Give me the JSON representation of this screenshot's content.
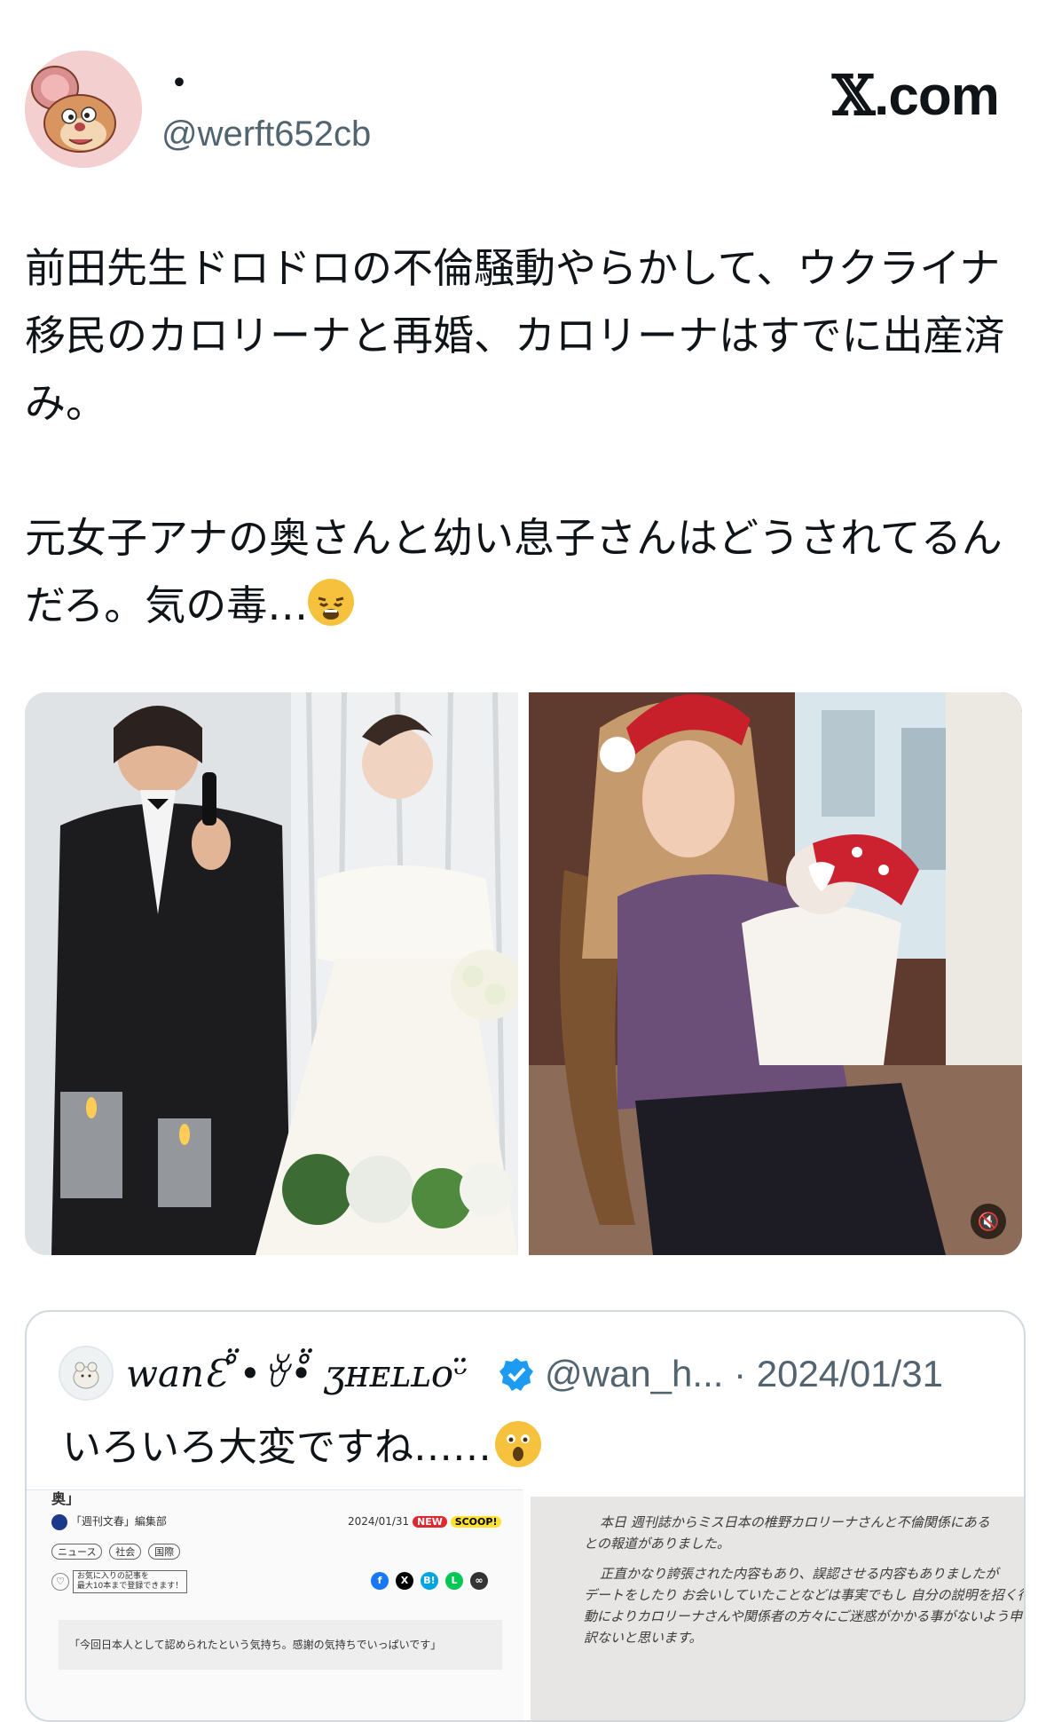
{
  "header": {
    "display_name": "・",
    "handle": "@werft652cb",
    "brand_x": "𝕏",
    "brand_suffix": ".com",
    "avatar_icon": "cartoon-mouse-avatar"
  },
  "tweet": {
    "line1": "前田先生ドロドロの不倫騒動やらかして、ウクライナ移民のカロリーナと再婚、カロリーナはすでに出産済み。",
    "line2": "元女子アナの奥さんと幼い息子さんはどうされてるんだろ。気の毒…",
    "emoji": "weary-face-emoji"
  },
  "media": {
    "items": [
      {
        "name": "wedding-photo",
        "icon": "photo"
      },
      {
        "name": "mother-baby-photo",
        "icon": "photo"
      }
    ],
    "mute_icon": "🔇"
  },
  "quote": {
    "display_name": "wanƐ ̊̈•ꈊ•̊̈ ʒʜᴇʟʟᴏᵕ̈",
    "handle_date": "@wan_h... · 2024/01/31",
    "text": "いろいろ大変ですね……",
    "verified_color": "#1d9bf0",
    "article": {
      "top_fragment": "奥」",
      "source": "「週刊文春」編集部",
      "date": "2024/01/31",
      "badge_new": "NEW",
      "badge_scoop": "SCOOP!",
      "tags": [
        "ニュース",
        "社会",
        "国際"
      ],
      "fav_note_1": "お気に入りの記事を",
      "fav_note_2": "最大10本まで登録できます！",
      "quote_line": "「今回日本人として認められたという気持ち。感謝の気持ちでいっぱいです」"
    },
    "letter": {
      "l1": "本日 週刊誌からミス日本の椎野カロリーナさんと不倫関係にある",
      "l2": "との報道がありました。",
      "l3": "正直かなり誇張された内容もあり、誤認させる内容もありましたが",
      "l4": "デートをしたり お会いしていたことなどは事実でもし 自分の説明を招く行",
      "l5": "動によりカロリーナさんや関係者の方々にご迷惑がかかる事がないよう申し",
      "l6": "訳ないと思います。"
    }
  }
}
